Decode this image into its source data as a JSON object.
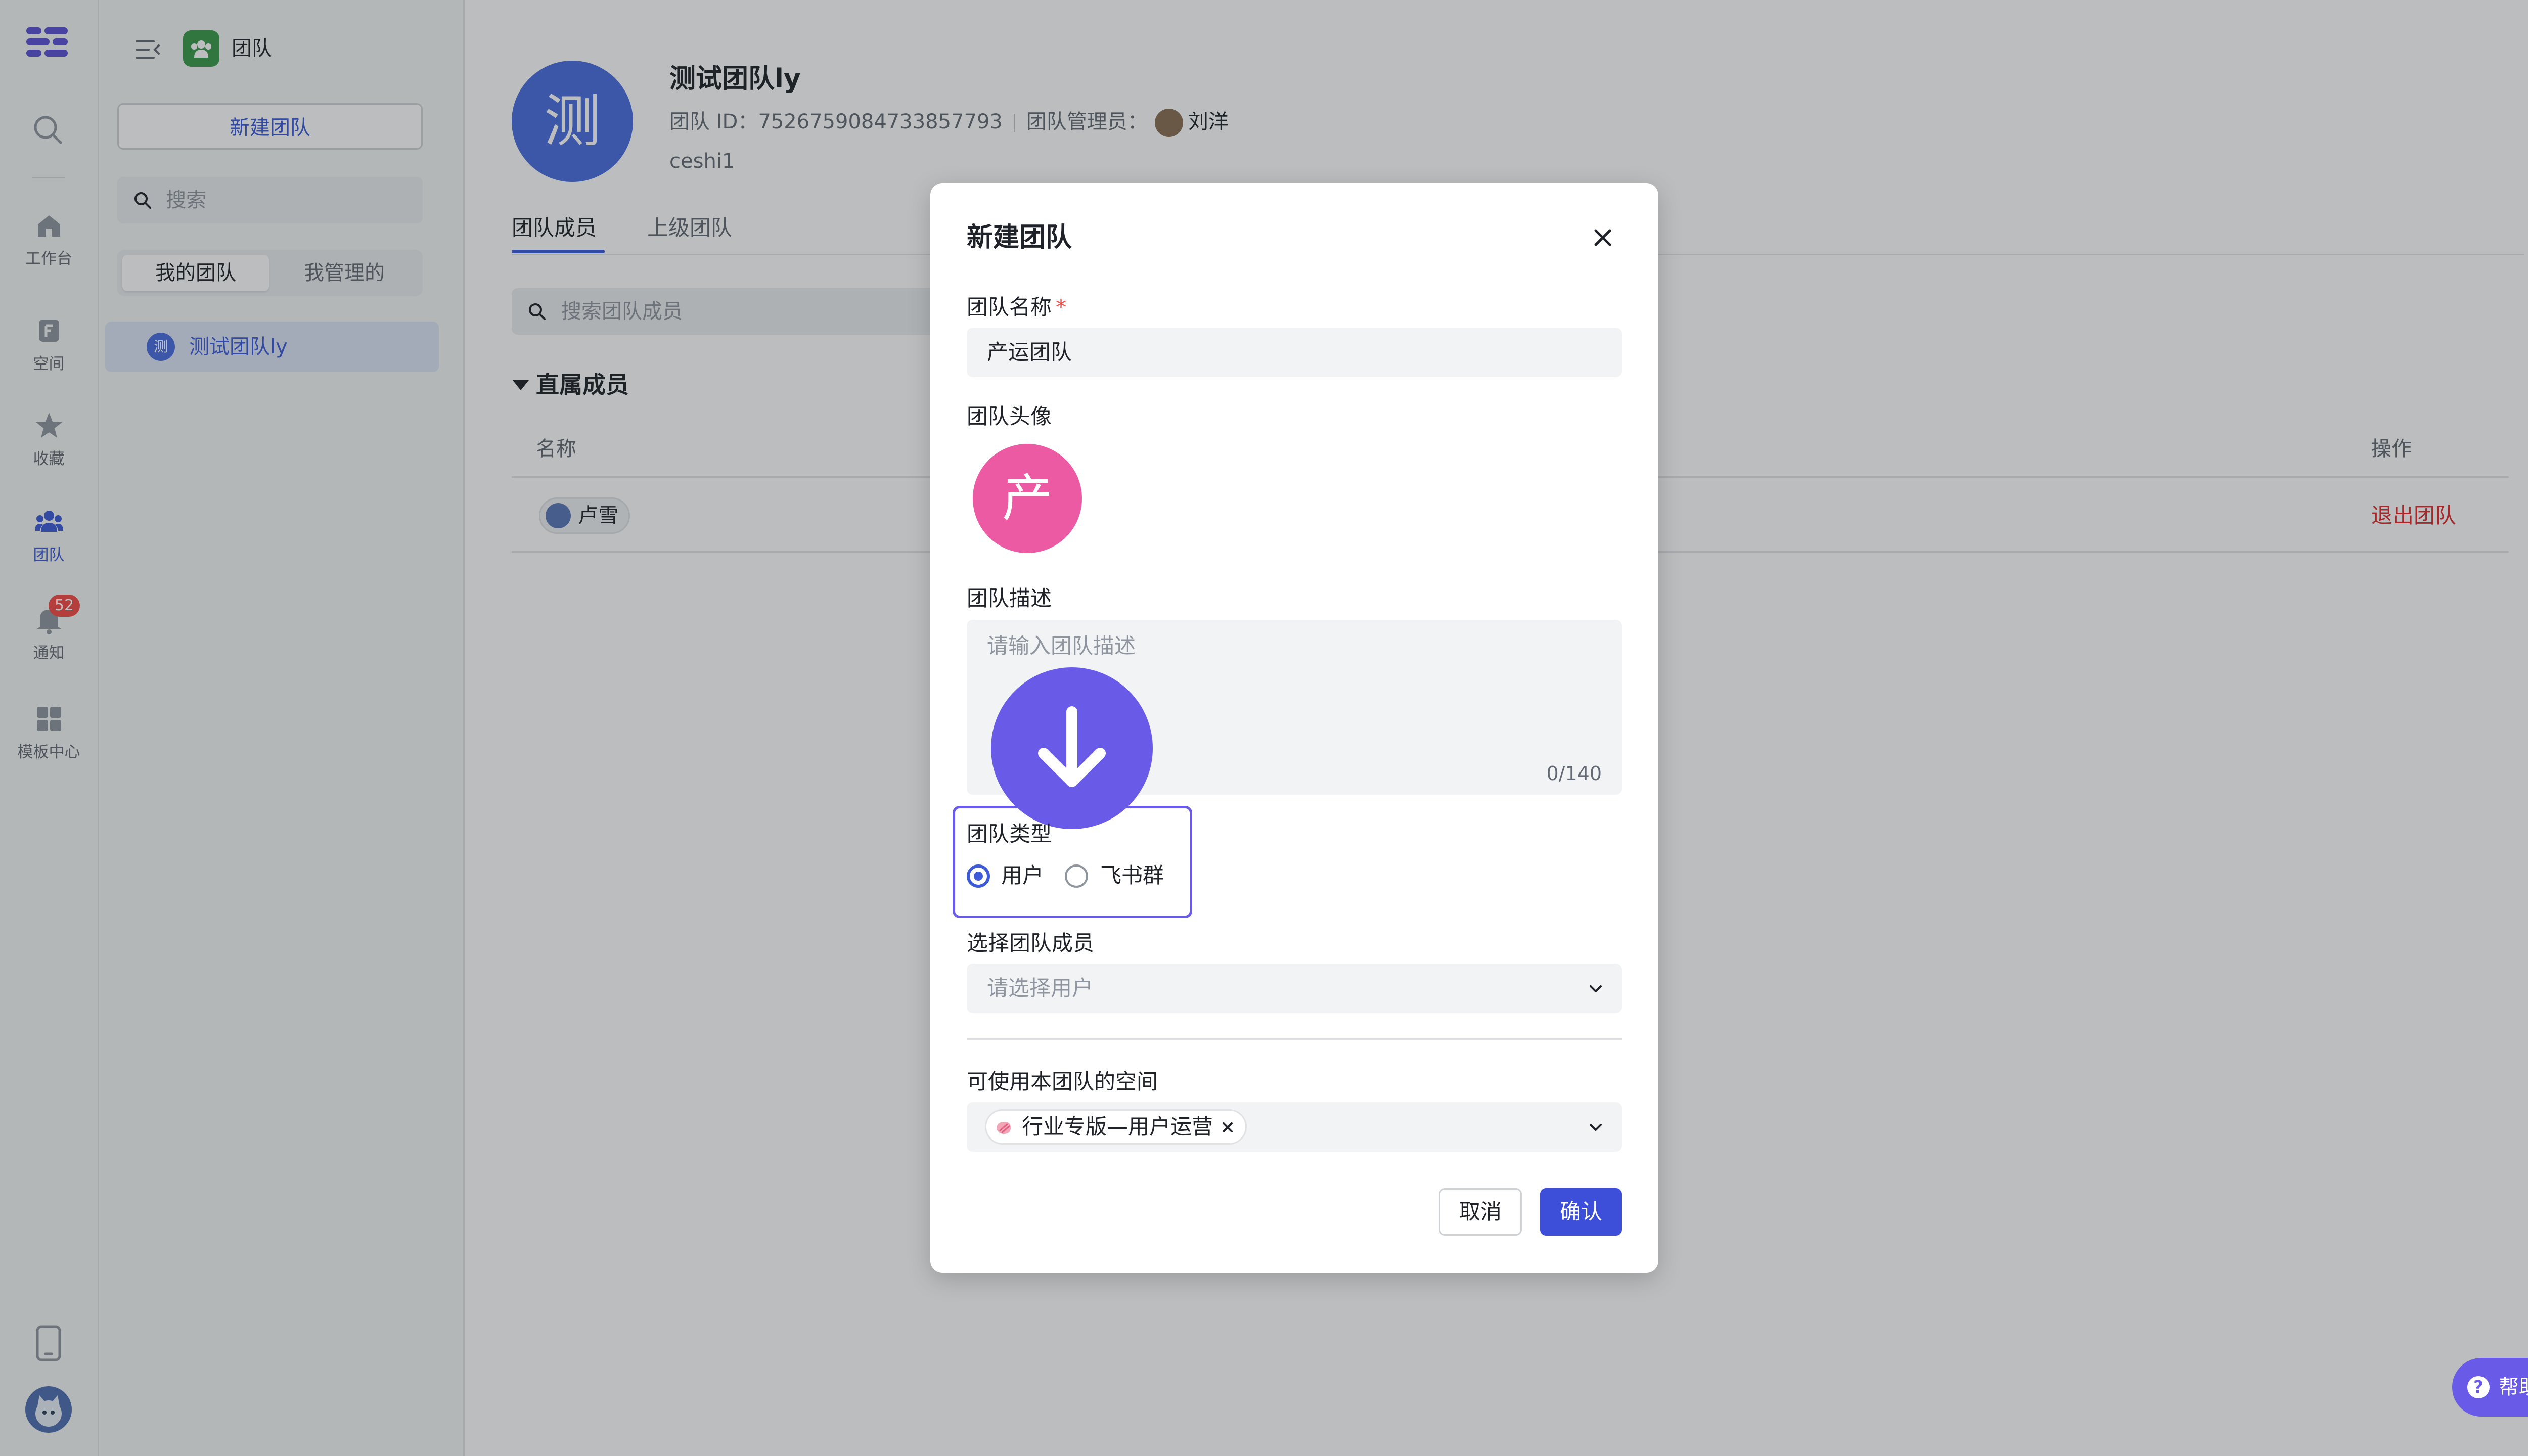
{
  "rail": {
    "items": [
      {
        "label": "工作台",
        "icon": "home-icon"
      },
      {
        "label": "空间",
        "icon": "space-icon"
      },
      {
        "label": "收藏",
        "icon": "star-icon"
      },
      {
        "label": "团队",
        "icon": "team-icon"
      },
      {
        "label": "通知",
        "icon": "bell-icon"
      },
      {
        "label": "模板中心",
        "icon": "template-icon"
      }
    ],
    "notification_badge": "52"
  },
  "panel": {
    "title": "团队",
    "new_team_button": "新建团队",
    "search_placeholder": "搜索",
    "segments": [
      "我的团队",
      "我管理的"
    ],
    "teams": [
      {
        "avatar_char": "测",
        "name": "测试团队ly"
      }
    ]
  },
  "team": {
    "avatar_char": "测",
    "name": "测试团队ly",
    "id_label": "团队 ID：",
    "id": "7526759084733857793",
    "manager_label": "团队管理员：",
    "manager": "刘洋",
    "description": "ceshi1"
  },
  "tabs": [
    "团队成员",
    "上级团队"
  ],
  "members": {
    "search_placeholder": "搜索团队成员",
    "section_title": "直属成员",
    "columns": {
      "name": "名称",
      "actions": "操作"
    },
    "rows": [
      {
        "name": "卢雪",
        "action": "退出团队"
      }
    ]
  },
  "modal": {
    "title": "新建团队",
    "name_label": "团队名称",
    "required_mark": "*",
    "name_value": "产运团队",
    "avatar_label": "团队头像",
    "avatar_char": "产",
    "desc_label": "团队描述",
    "desc_placeholder": "请输入团队描述",
    "desc_count": "0/140",
    "type_label": "团队类型",
    "type_options": [
      "用户",
      "飞书群"
    ],
    "type_selected": "用户",
    "members_label": "选择团队成员",
    "members_placeholder": "请选择用户",
    "space_label": "可使用本团队的空间",
    "space_tags": [
      "行业专版—用户运营"
    ],
    "cancel": "取消",
    "confirm": "确认"
  },
  "help": {
    "label": "帮助"
  },
  "colors": {
    "accent": "#3d5bd9",
    "confirm_button": "#3d4fd9",
    "danger": "#e02b2b",
    "team_avatar": "#4a6ee0",
    "modal_avatar": "#ec5aa4",
    "highlight": "#6a5ae8"
  }
}
